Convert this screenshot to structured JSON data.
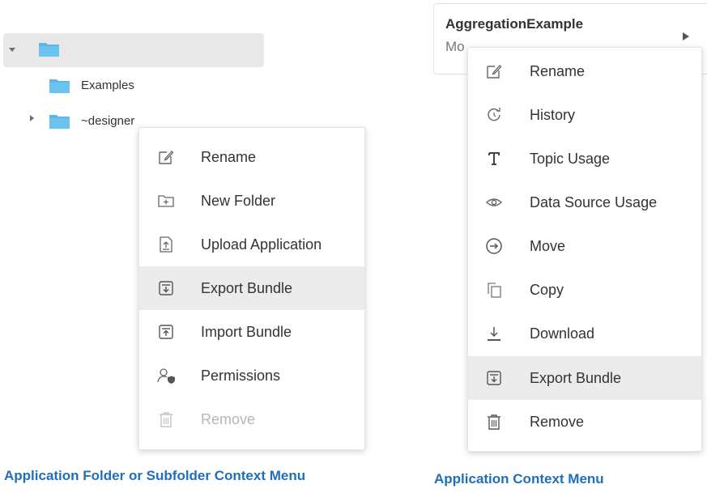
{
  "tree": {
    "items": [
      {
        "label": "",
        "icon": "folder-icon"
      },
      {
        "label": "Examples",
        "icon": "folder-icon"
      },
      {
        "label": "~designer",
        "icon": "folder-icon"
      }
    ]
  },
  "folder_menu": {
    "items": [
      {
        "label": "Rename",
        "icon": "rename-icon"
      },
      {
        "label": "New Folder",
        "icon": "new-folder-icon"
      },
      {
        "label": "Upload Application",
        "icon": "upload-icon"
      },
      {
        "label": "Export Bundle",
        "icon": "export-bundle-icon",
        "highlighted": true
      },
      {
        "label": "Import Bundle",
        "icon": "import-bundle-icon"
      },
      {
        "label": "Permissions",
        "icon": "permissions-icon"
      },
      {
        "label": "Remove",
        "icon": "trash-icon",
        "disabled": true
      }
    ],
    "caption": "Application Folder or Subfolder Context Menu"
  },
  "app_card": {
    "title": "AggregationExample",
    "subtitle": "Mo"
  },
  "app_menu": {
    "items": [
      {
        "label": "Rename",
        "icon": "rename-icon"
      },
      {
        "label": "History",
        "icon": "history-icon"
      },
      {
        "label": "Topic Usage",
        "icon": "topic-icon"
      },
      {
        "label": "Data Source Usage",
        "icon": "eye-icon"
      },
      {
        "label": "Move",
        "icon": "move-icon"
      },
      {
        "label": "Copy",
        "icon": "copy-icon"
      },
      {
        "label": "Download",
        "icon": "download-icon"
      },
      {
        "label": "Export Bundle",
        "icon": "export-bundle-icon",
        "highlighted": true
      },
      {
        "label": "Remove",
        "icon": "trash-icon"
      }
    ],
    "caption": "Application Context Menu"
  },
  "colors": {
    "caption": "#1f6fba",
    "folder": "#5ab8e8",
    "highlight": "#ebebeb"
  }
}
